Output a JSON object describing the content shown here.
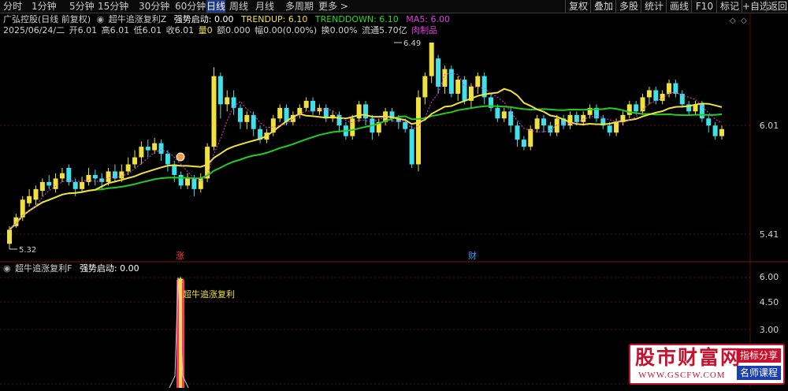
{
  "toolbar": {
    "timeframes": [
      "分时",
      "1分钟",
      "5分钟",
      "15分钟",
      "30分钟",
      "60分钟",
      "日线",
      "周线",
      "月线",
      "多周期",
      "更多 >"
    ],
    "active": "日线",
    "right_buttons": [
      "复权",
      "叠加",
      "多股",
      "统计",
      "画线",
      "F10",
      "标记",
      "+自选",
      "返回"
    ]
  },
  "main_header": {
    "stock": "广弘控股(日线 前复权)",
    "indicator": "超牛追涨复利Z",
    "strength_label": "强势启动: 0.00",
    "trendup": "TRENDUP: 6.10",
    "trenddown": "TRENDDOWN: 6.10",
    "ma5": "MA5: 6.00"
  },
  "quote_line": {
    "date": "2025/06/24/二",
    "open": "开6.01",
    "high": "高6.01",
    "low": "低6.01",
    "close": "收6.01",
    "vol": "量0",
    "amount": "额0.000",
    "amp": "幅0.00(0.00%)",
    "turnover": "换0.00%",
    "float": "流通5.70亿",
    "sector": "肉制品"
  },
  "price_axis": [
    "6.01",
    "5.41"
  ],
  "sub_axis": [
    "6.00",
    "4.50",
    "3.00"
  ],
  "annotations": {
    "high_label": "6.49",
    "low_label": "5.32",
    "zhang": "涨",
    "cai": "财",
    "signal": "超牛追涨复利"
  },
  "sub_header": {
    "indicator": "超牛追涨复利F",
    "strength": "强势启动: 0.00"
  },
  "watermark": {
    "big": "股市财富网",
    "url": "WWW.GSCFW.COM",
    "tag1": "指标分享",
    "tag2": "名师课程"
  },
  "colors": {
    "up": "#f0e040",
    "down": "#40e0e8",
    "ma_green": "#22cc22",
    "ma_yellow": "#f0e040",
    "grid": "#5a1010"
  },
  "chart_data": {
    "type": "candlestick",
    "price_high": 6.49,
    "price_low": 5.32,
    "candles": [
      [
        5.35,
        5.43,
        5.32,
        5.45
      ],
      [
        5.45,
        5.5,
        5.44,
        5.52
      ],
      [
        5.5,
        5.6,
        5.48,
        5.62
      ],
      [
        5.58,
        5.62,
        5.56,
        5.66
      ],
      [
        5.6,
        5.66,
        5.57,
        5.68
      ],
      [
        5.65,
        5.7,
        5.62,
        5.72
      ],
      [
        5.7,
        5.68,
        5.66,
        5.74
      ],
      [
        5.66,
        5.72,
        5.64,
        5.75
      ],
      [
        5.72,
        5.75,
        5.7,
        5.78
      ],
      [
        5.78,
        5.7,
        5.68,
        5.8
      ],
      [
        5.7,
        5.66,
        5.62,
        5.72
      ],
      [
        5.66,
        5.7,
        5.64,
        5.73
      ],
      [
        5.7,
        5.74,
        5.68,
        5.78
      ],
      [
        5.74,
        5.72,
        5.68,
        5.77
      ],
      [
        5.72,
        5.7,
        5.66,
        5.75
      ],
      [
        5.7,
        5.76,
        5.68,
        5.78
      ],
      [
        5.76,
        5.72,
        5.7,
        5.8
      ],
      [
        5.72,
        5.76,
        5.7,
        5.8
      ],
      [
        5.76,
        5.8,
        5.74,
        5.84
      ],
      [
        5.8,
        5.84,
        5.78,
        5.88
      ],
      [
        5.84,
        5.9,
        5.8,
        5.93
      ],
      [
        5.9,
        5.88,
        5.84,
        5.94
      ],
      [
        5.88,
        5.92,
        5.86,
        5.95
      ],
      [
        5.92,
        5.86,
        5.82,
        5.94
      ],
      [
        5.86,
        5.8,
        5.76,
        5.88
      ],
      [
        5.8,
        5.74,
        5.7,
        5.82
      ],
      [
        5.74,
        5.68,
        5.66,
        5.76
      ],
      [
        5.68,
        5.72,
        5.66,
        5.75
      ],
      [
        5.72,
        5.66,
        5.62,
        5.74
      ],
      [
        5.66,
        5.72,
        5.64,
        5.75
      ],
      [
        5.72,
        5.9,
        5.7,
        5.92
      ],
      [
        5.9,
        6.3,
        5.88,
        6.35
      ],
      [
        6.3,
        6.14,
        6.06,
        6.32
      ],
      [
        6.14,
        6.18,
        6.1,
        6.22
      ],
      [
        6.18,
        6.12,
        6.08,
        6.22
      ],
      [
        6.12,
        6.04,
        6.0,
        6.14
      ],
      [
        6.04,
        6.08,
        6.0,
        6.1
      ],
      [
        6.08,
        6.0,
        5.96,
        6.1
      ],
      [
        6.0,
        5.94,
        5.92,
        6.02
      ],
      [
        5.94,
        5.98,
        5.92,
        6.0
      ],
      [
        5.98,
        6.06,
        5.96,
        6.08
      ],
      [
        6.06,
        6.12,
        6.04,
        6.14
      ],
      [
        6.12,
        6.04,
        6.02,
        6.14
      ],
      [
        6.04,
        6.08,
        6.02,
        6.1
      ],
      [
        6.08,
        6.12,
        6.06,
        6.14
      ],
      [
        6.12,
        6.16,
        6.1,
        6.18
      ],
      [
        6.16,
        6.1,
        6.08,
        6.18
      ],
      [
        6.1,
        6.12,
        6.08,
        6.14
      ],
      [
        6.12,
        6.06,
        6.04,
        6.14
      ],
      [
        6.06,
        6.08,
        6.04,
        6.1
      ],
      [
        6.08,
        6.02,
        5.98,
        6.1
      ],
      [
        6.02,
        5.96,
        5.94,
        6.04
      ],
      [
        5.96,
        6.06,
        5.94,
        6.08
      ],
      [
        6.06,
        6.14,
        6.04,
        6.16
      ],
      [
        6.14,
        6.06,
        6.02,
        6.16
      ],
      [
        6.06,
        5.98,
        5.94,
        6.08
      ],
      [
        5.98,
        6.04,
        5.96,
        6.06
      ],
      [
        6.04,
        6.1,
        6.02,
        6.12
      ],
      [
        6.1,
        6.06,
        6.04,
        6.12
      ],
      [
        6.06,
        6.04,
        6.0,
        6.08
      ],
      [
        6.04,
        6.0,
        5.98,
        6.06
      ],
      [
        6.0,
        5.8,
        5.78,
        6.02
      ],
      [
        5.8,
        6.18,
        5.76,
        6.22
      ],
      [
        6.18,
        6.3,
        6.14,
        6.32
      ],
      [
        6.3,
        6.49,
        6.26,
        6.49
      ],
      [
        6.4,
        6.24,
        6.2,
        6.42
      ],
      [
        6.24,
        6.34,
        6.2,
        6.36
      ],
      [
        6.34,
        6.2,
        6.18,
        6.36
      ],
      [
        6.2,
        6.28,
        6.16,
        6.3
      ],
      [
        6.28,
        6.16,
        6.14,
        6.3
      ],
      [
        6.16,
        6.24,
        6.12,
        6.26
      ],
      [
        6.24,
        6.3,
        6.2,
        6.32
      ],
      [
        6.3,
        6.18,
        6.14,
        6.32
      ],
      [
        6.18,
        6.12,
        6.1,
        6.2
      ],
      [
        6.12,
        6.06,
        6.04,
        6.14
      ],
      [
        6.06,
        6.1,
        6.04,
        6.12
      ],
      [
        6.1,
        6.02,
        5.98,
        6.12
      ],
      [
        6.02,
        5.94,
        5.9,
        6.04
      ],
      [
        5.94,
        5.9,
        5.88,
        5.96
      ],
      [
        5.9,
        6.0,
        5.88,
        6.02
      ],
      [
        6.0,
        6.06,
        5.98,
        6.08
      ],
      [
        6.06,
        6.02,
        5.98,
        6.08
      ],
      [
        6.02,
        5.98,
        5.96,
        6.04
      ],
      [
        5.98,
        6.06,
        5.96,
        6.08
      ],
      [
        6.06,
        6.02,
        6.0,
        6.08
      ],
      [
        6.02,
        6.08,
        6.0,
        6.1
      ],
      [
        6.08,
        6.04,
        6.02,
        6.1
      ],
      [
        6.04,
        6.08,
        6.02,
        6.1
      ],
      [
        6.08,
        6.12,
        6.06,
        6.14
      ],
      [
        6.12,
        6.06,
        6.04,
        6.14
      ],
      [
        6.06,
        6.02,
        6.0,
        6.08
      ],
      [
        6.02,
        5.98,
        5.96,
        6.04
      ],
      [
        5.98,
        6.04,
        5.96,
        6.06
      ],
      [
        6.04,
        6.08,
        6.02,
        6.1
      ],
      [
        6.08,
        6.14,
        6.06,
        6.16
      ],
      [
        6.14,
        6.1,
        6.08,
        6.16
      ],
      [
        6.1,
        6.18,
        6.08,
        6.2
      ],
      [
        6.18,
        6.22,
        6.14,
        6.24
      ],
      [
        6.22,
        6.16,
        6.14,
        6.24
      ],
      [
        6.16,
        6.2,
        6.14,
        6.22
      ],
      [
        6.2,
        6.26,
        6.18,
        6.28
      ],
      [
        6.26,
        6.2,
        6.18,
        6.28
      ],
      [
        6.2,
        6.14,
        6.12,
        6.22
      ],
      [
        6.14,
        6.1,
        6.08,
        6.16
      ],
      [
        6.1,
        6.14,
        6.08,
        6.16
      ],
      [
        6.14,
        6.06,
        6.04,
        6.16
      ],
      [
        6.06,
        6.02,
        5.98,
        6.08
      ],
      [
        6.02,
        5.96,
        5.94,
        6.04
      ],
      [
        5.96,
        6.0,
        5.94,
        6.02
      ]
    ]
  }
}
